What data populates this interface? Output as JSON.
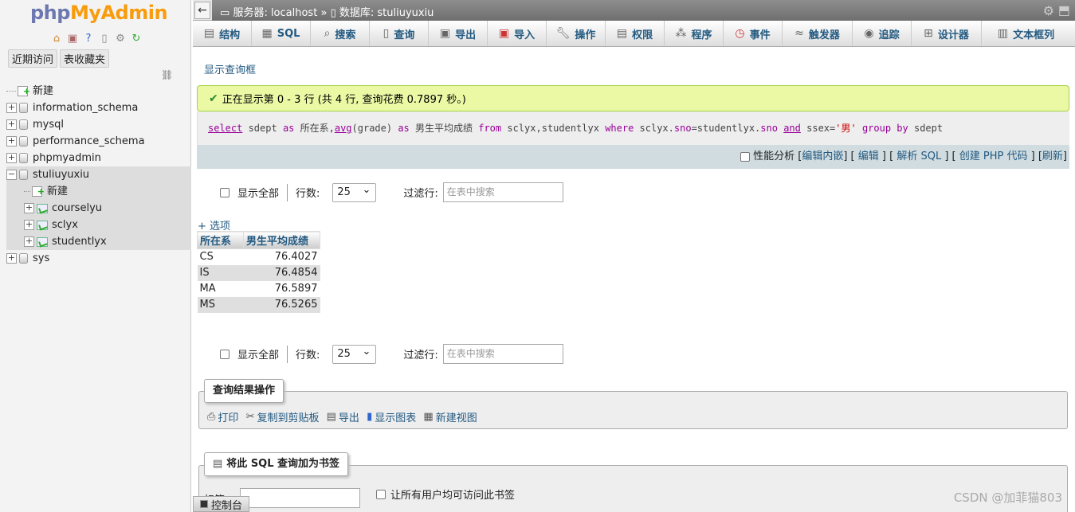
{
  "sidebar": {
    "logo_php": "php",
    "logo_myadmin": "MyAdmin",
    "recent_tab": "近期访问",
    "favorites_tab": "表收藏夹",
    "tree": [
      {
        "label": "新建",
        "type": "new"
      },
      {
        "label": "information_schema",
        "type": "db"
      },
      {
        "label": "mysql",
        "type": "db"
      },
      {
        "label": "performance_schema",
        "type": "db"
      },
      {
        "label": "phpmyadmin",
        "type": "db"
      },
      {
        "label": "stuliuyuxiu",
        "type": "db",
        "expanded": true
      },
      {
        "label": "新建",
        "type": "new-table"
      },
      {
        "label": "courselyu",
        "type": "table"
      },
      {
        "label": "sclyx",
        "type": "table"
      },
      {
        "label": "studentlyx",
        "type": "table"
      },
      {
        "label": "sys",
        "type": "db"
      }
    ]
  },
  "topbar": {
    "server_label": "服务器: localhost",
    "separator": "»",
    "db_label": "数据库: stuliuyuxiu"
  },
  "menu": [
    {
      "label": "结构",
      "icon": "structure-icon"
    },
    {
      "label": "SQL",
      "icon": "sql-icon"
    },
    {
      "label": "搜索",
      "icon": "search-icon"
    },
    {
      "label": "查询",
      "icon": "query-icon"
    },
    {
      "label": "导出",
      "icon": "export-icon"
    },
    {
      "label": "导入",
      "icon": "import-icon"
    },
    {
      "label": "操作",
      "icon": "wrench-icon"
    },
    {
      "label": "权限",
      "icon": "privileges-icon"
    },
    {
      "label": "程序",
      "icon": "routines-icon"
    },
    {
      "label": "事件",
      "icon": "clock-icon"
    },
    {
      "label": "触发器",
      "icon": "triggers-icon"
    },
    {
      "label": "追踪",
      "icon": "eye-icon"
    },
    {
      "label": "设计器",
      "icon": "designer-icon"
    },
    {
      "label": "文本框列",
      "icon": "columns-icon"
    }
  ],
  "main": {
    "show_query_link": "显示查询框",
    "success_message": "正在显示第 0 - 3 行 (共 4 行, 查询花费 0.7897 秒。)",
    "sql": {
      "select": "select",
      "t1": " sdept ",
      "as1": "as",
      "t2": " 所在系,",
      "avg": "avg",
      "t3": "(grade) ",
      "as2": "as",
      "t4": " 男生平均成绩 ",
      "from": "from",
      "t5": " sclyx,studentlyx ",
      "where": "where",
      "t6": " sclyx.",
      "sno1": "sno",
      "t7": "=studentlyx.",
      "sno2": "sno",
      "t8": " ",
      "and": "and",
      "t9": " ssex=",
      "str": "'男'",
      "t10": " ",
      "group": "group",
      "t11": " ",
      "by": "by",
      "t12": " sdept"
    },
    "sql_links": {
      "profiling": "性能分析",
      "edit_inline": "编辑内嵌",
      "edit": "编辑",
      "explain": "解析 SQL",
      "create_php": "创建 PHP 代码",
      "refresh": "刷新"
    },
    "nav": {
      "show_all": "显示全部",
      "rows_label": "行数:",
      "rows_value": "25",
      "filter_label": "过滤行:",
      "filter_placeholder": "在表中搜索"
    },
    "options_link": "+ 选项",
    "table": {
      "headers": [
        "所在系",
        "男生平均成绩"
      ],
      "rows": [
        [
          "CS",
          "76.4027"
        ],
        [
          "IS",
          "76.4854"
        ],
        [
          "MA",
          "76.5897"
        ],
        [
          "MS",
          "76.5265"
        ]
      ]
    },
    "query_ops": {
      "legend": "查询结果操作",
      "print": "打印",
      "copy": "复制到剪贴板",
      "export": "导出",
      "chart": "显示图表",
      "view": "新建视图"
    },
    "bookmark": {
      "legend": "将此 SQL 查询加为书签",
      "label": "标签:",
      "shared": "让所有用户均可访问此书签"
    }
  },
  "console_label": "控制台",
  "watermark": "CSDN @加菲猫803"
}
